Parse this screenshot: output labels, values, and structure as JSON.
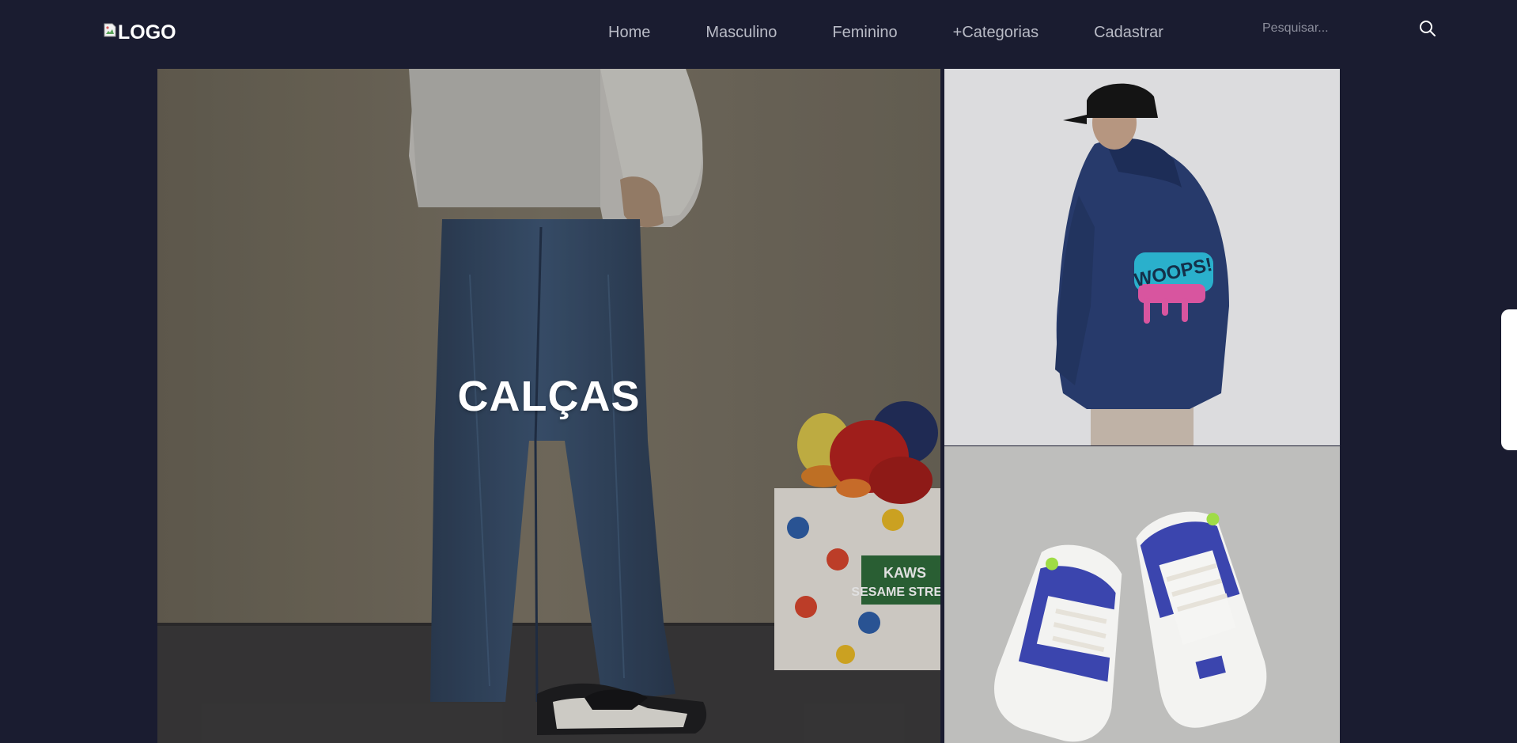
{
  "navbar": {
    "logo_text": "LOGO",
    "links": [
      "Home",
      "Masculino",
      "Feminino",
      "+Categorias",
      "Cadastrar"
    ],
    "search_placeholder": "Pesquisar..."
  },
  "hero": {
    "main_tile_label": "CALÇAS",
    "sesame_box_text_1": "KAWS",
    "sesame_box_text_2": "SESAME STREET",
    "hoodie_print_text": "WOOPS!"
  },
  "colors": {
    "background": "#1a1c30",
    "nav_text": "#b9bbc6",
    "label_text": "#ffffff"
  },
  "icons": {
    "search": "search-icon",
    "broken_image": "broken-image-icon"
  }
}
